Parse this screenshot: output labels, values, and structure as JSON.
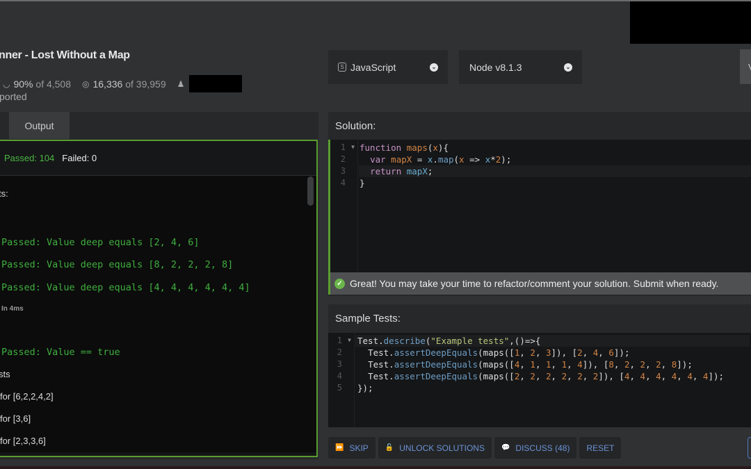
{
  "header": {
    "title": "nner - Lost Without a Map",
    "stats": {
      "satisfaction": "90%",
      "satisfaction_of": "of 4,508",
      "completions": "16,336",
      "completions_of": "of 39,959"
    },
    "subtitle": "ported",
    "icons": {
      "satisfaction": "gauge-icon",
      "completions": "target-icon",
      "author": "user-icon"
    }
  },
  "dropdowns": {
    "language": "JavaScript",
    "version": "Node v8.1.3"
  },
  "view_button_label": "V",
  "left_panel": {
    "tab_output": "Output",
    "summary": {
      "passed": "Passed: 104",
      "failed": "Failed: 0"
    },
    "lines": [
      {
        "text": "ts:",
        "kind": "plain"
      },
      {
        "text": "Passed: Value deep equals [2, 4, 6]",
        "kind": "green"
      },
      {
        "text": "Passed: Value deep equals [8, 2, 2, 2, 8]",
        "kind": "green"
      },
      {
        "text": "Passed: Value deep equals [4, 4, 4, 4, 4, 4]",
        "kind": "green"
      },
      {
        "text": "In 4ms",
        "kind": "small"
      },
      {
        "text": "Passed: Value == true",
        "kind": "green"
      },
      {
        "text": "sts",
        "kind": "plain"
      },
      {
        "text": "for [6,2,2,4,2]",
        "kind": "plain"
      },
      {
        "text": "for [3,6]",
        "kind": "plain"
      },
      {
        "text": "for [2,3,3,6]",
        "kind": "plain"
      }
    ]
  },
  "solution": {
    "heading": "Solution:",
    "line_numbers": [
      "1",
      "2",
      "3",
      "4"
    ],
    "code": [
      "function maps(x){",
      "  var mapX = x.map(x => x*2);",
      "  return mapX;",
      "}"
    ]
  },
  "success_message": "Great! You may take your time to refactor/comment your solution. Submit when ready.",
  "sample_tests": {
    "heading": "Sample Tests:",
    "line_numbers": [
      "1",
      "2",
      "3",
      "4",
      "5"
    ],
    "code": [
      "Test.describe(\"Example tests\",()=>{",
      "  Test.assertDeepEquals(maps([1, 2, 3]), [2, 4, 6]);",
      "  Test.assertDeepEquals(maps([4, 1, 1, 1, 4]), [8, 2, 2, 2, 8]);",
      "  Test.assertDeepEquals(maps([2, 2, 2, 2, 2, 2]), [4, 4, 4, 4, 4, 4]);",
      "});"
    ]
  },
  "actions": {
    "skip": "SKIP",
    "unlock": "UNLOCK SOLUTIONS",
    "discuss": "DISCUSS (48)",
    "reset": "RESET"
  },
  "colors": {
    "accent_green": "#5a9e2f",
    "pass_text": "#3fae3f",
    "action_blue": "#6b93d6",
    "background": "#303133"
  }
}
